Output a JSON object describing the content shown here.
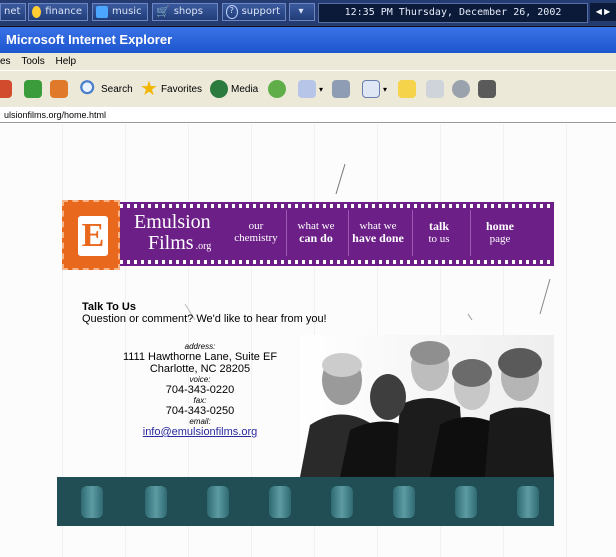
{
  "taskbar": {
    "items": [
      {
        "label": "net",
        "icon": "globe-icon",
        "color": "#2e74ff"
      },
      {
        "label": "finance",
        "icon": "finance-icon",
        "color": "#ffcc33"
      },
      {
        "label": "music",
        "icon": "music-icon",
        "color": "#4aa6ff"
      },
      {
        "label": "shops",
        "icon": "cart-icon",
        "color": "#bcd3ff"
      },
      {
        "label": "support",
        "icon": "help-icon",
        "color": "#bcd3ff"
      }
    ],
    "dropdown_glyph": "▾",
    "clock": "12:35 PM Thursday, December 26, 2002",
    "arrows": "◀ ▶"
  },
  "window": {
    "title": "Microsoft Internet Explorer"
  },
  "menu": [
    "es",
    "Tools",
    "Help"
  ],
  "toolbar": {
    "items": [
      {
        "label": "",
        "icon": "stop-icon"
      },
      {
        "label": "",
        "icon": "refresh-icon"
      },
      {
        "label": "",
        "icon": "home-icon"
      },
      {
        "label": "Search",
        "icon": "search-icon"
      },
      {
        "label": "Favorites",
        "icon": "favorites-star-icon"
      },
      {
        "label": "Media",
        "icon": "media-icon"
      },
      {
        "label": "",
        "icon": "history-icon"
      },
      {
        "label": "",
        "icon": "mail-icon"
      },
      {
        "label": "",
        "icon": "print-icon"
      },
      {
        "label": "",
        "icon": "word-icon"
      },
      {
        "label": "",
        "icon": "folder-icon"
      },
      {
        "label": "",
        "icon": "edit-icon"
      },
      {
        "label": "",
        "icon": "messenger-icon"
      },
      {
        "label": "",
        "icon": "msn-icon"
      }
    ]
  },
  "address": {
    "url": "ulsionfilms.org/home.html"
  },
  "site": {
    "logo_letter": "E",
    "brand_line1": "Emulsion",
    "brand_line2": "Films",
    "brand_suffix": ".org",
    "nav": [
      {
        "top": "our",
        "bottom": "chemistry"
      },
      {
        "top": "what we",
        "bottom": "can do"
      },
      {
        "top": "what we",
        "bottom": "have done"
      },
      {
        "top": "talk",
        "bottom": "to us"
      },
      {
        "top": "home",
        "bottom": "page"
      }
    ],
    "talk_heading": "Talk To Us",
    "talk_sub": "Question or comment? We'd like to hear from you!",
    "address_label": "address:",
    "address_line1": "1111 Hawthorne Lane, Suite EF",
    "address_line2": "Charlotte, NC 28205",
    "voice_label": "voice:",
    "voice": "704-343-0220",
    "fax_label": "fax:",
    "fax": "704-343-0250",
    "email_label": "email:",
    "email": "info@emulsionfilms.org",
    "colors": {
      "purple": "#6c1f87",
      "orange": "#e8681e",
      "teal": "#204e54"
    }
  }
}
